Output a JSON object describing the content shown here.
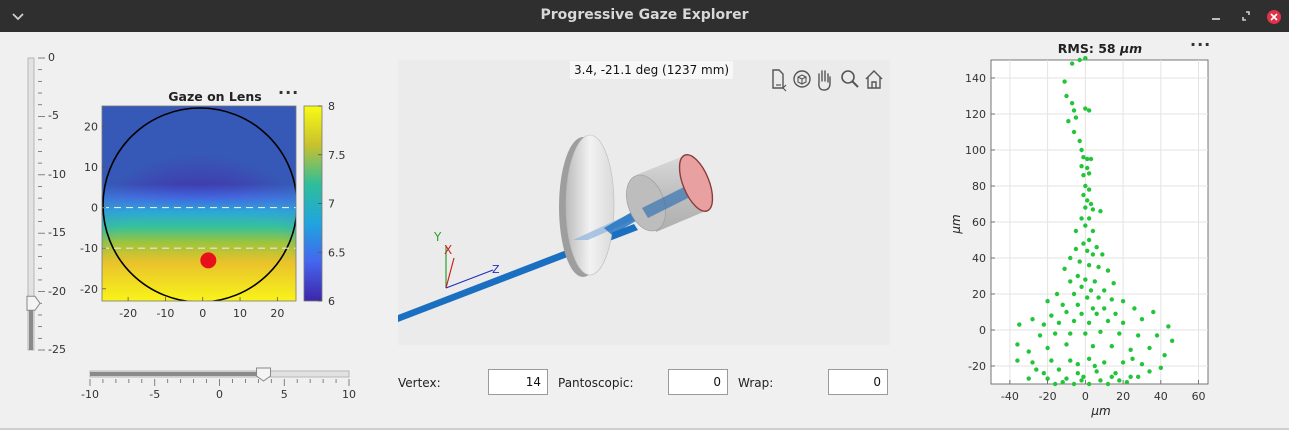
{
  "window": {
    "title": "Progressive Gaze Explorer",
    "colors": {
      "titlebar": "#2f2f2f",
      "close": "#e0334a"
    }
  },
  "vertical_slider": {
    "ticks": [
      "0",
      "-5",
      "-10",
      "-15",
      "-20",
      "-25"
    ],
    "min": -25,
    "max": 0,
    "value": -21
  },
  "horizontal_slider": {
    "ticks": [
      "-10",
      "-5",
      "0",
      "5",
      "10"
    ],
    "min": -10,
    "max": 10,
    "value": 3.4
  },
  "gaze_panel": {
    "title": "Gaze on Lens",
    "x_ticks": [
      "-20",
      "-10",
      "0",
      "10",
      "20"
    ],
    "y_ticks": [
      "20",
      "10",
      "0",
      "-10",
      "-20"
    ],
    "colorbar_ticks": [
      "8",
      "7.5",
      "7",
      "6.5",
      "6"
    ],
    "colorbar_range": [
      6,
      8
    ],
    "gaze_point": {
      "x": 1.5,
      "y": -13
    },
    "dashed_lines_y": [
      0,
      -10
    ],
    "marker_color": "#e8101a"
  },
  "scene_panel": {
    "readout": "3.4, -21.1 deg (1237 mm)",
    "axis_labels": {
      "y": "Y",
      "x": "X",
      "z": "Z"
    },
    "toolbar_icons": [
      "export-icon",
      "rotate-3d-icon",
      "pan-hand-icon",
      "zoom-icon",
      "home-icon"
    ],
    "colors": {
      "ray": "#1a6fc0",
      "lens": "#e6e6e6",
      "eye_cornea": "#e8a0a0"
    }
  },
  "fields": {
    "vertex": {
      "label": "Vertex:",
      "value": "14"
    },
    "pantoscopic": {
      "label": "Pantoscopic:",
      "value": "0"
    },
    "wrap": {
      "label": "Wrap:",
      "value": "0"
    }
  },
  "spot_panel": {
    "title_prefix": "RMS: 58 ",
    "title_unit": "μm",
    "xlabel": "μm",
    "ylabel": "μm"
  },
  "chart_data": {
    "type": "scatter",
    "title": "RMS: 58 μm",
    "xlabel": "μm",
    "ylabel": "μm",
    "xlim": [
      -50,
      65
    ],
    "ylim": [
      -30,
      150
    ],
    "x_ticks": [
      -40,
      -20,
      0,
      20,
      40,
      60
    ],
    "y_ticks": [
      140,
      120,
      100,
      80,
      60,
      40,
      20,
      0,
      -20
    ],
    "grid": true,
    "marker_color": "#22c43a",
    "points": [
      [
        -7,
        148
      ],
      [
        -3,
        150
      ],
      [
        0,
        151
      ],
      [
        -11,
        138
      ],
      [
        -10,
        130
      ],
      [
        -7,
        126
      ],
      [
        -6,
        122
      ],
      [
        -5,
        118
      ],
      [
        0,
        123
      ],
      [
        2,
        122
      ],
      [
        -9,
        116
      ],
      [
        -6,
        110
      ],
      [
        -3,
        105
      ],
      [
        -2,
        100
      ],
      [
        -1,
        96
      ],
      [
        1,
        95
      ],
      [
        3,
        95
      ],
      [
        -2,
        91
      ],
      [
        1,
        90
      ],
      [
        2,
        87
      ],
      [
        -1,
        86
      ],
      [
        0,
        80
      ],
      [
        2,
        78
      ],
      [
        -1,
        75
      ],
      [
        1,
        72
      ],
      [
        3,
        70
      ],
      [
        0,
        68
      ],
      [
        4,
        67
      ],
      [
        8,
        66
      ],
      [
        -2,
        62
      ],
      [
        2,
        62
      ],
      [
        0,
        58
      ],
      [
        -5,
        55
      ],
      [
        4,
        55
      ],
      [
        2,
        50
      ],
      [
        -1,
        48
      ],
      [
        6,
        46
      ],
      [
        -5,
        45
      ],
      [
        1,
        44
      ],
      [
        4,
        42
      ],
      [
        9,
        42
      ],
      [
        -8,
        40
      ],
      [
        -3,
        38
      ],
      [
        2,
        36
      ],
      [
        7,
        35
      ],
      [
        12,
        33
      ],
      [
        -11,
        34
      ],
      [
        -4,
        30
      ],
      [
        0,
        28
      ],
      [
        5,
        27
      ],
      [
        15,
        26
      ],
      [
        -8,
        27
      ],
      [
        -2,
        24
      ],
      [
        3,
        22
      ],
      [
        10,
        22
      ],
      [
        -15,
        20
      ],
      [
        -6,
        20
      ],
      [
        1,
        18
      ],
      [
        7,
        18
      ],
      [
        14,
        17
      ],
      [
        20,
        16
      ],
      [
        -20,
        16
      ],
      [
        -12,
        14
      ],
      [
        -4,
        14
      ],
      [
        4,
        12
      ],
      [
        10,
        12
      ],
      [
        -2,
        9
      ],
      [
        6,
        9
      ],
      [
        16,
        9
      ],
      [
        26,
        12
      ],
      [
        -10,
        10
      ],
      [
        -18,
        8
      ],
      [
        -22,
        3
      ],
      [
        -14,
        4
      ],
      [
        -6,
        5
      ],
      [
        2,
        4
      ],
      [
        12,
        5
      ],
      [
        20,
        4
      ],
      [
        30,
        6
      ],
      [
        36,
        10
      ],
      [
        -35,
        3
      ],
      [
        -28,
        6
      ],
      [
        -24,
        -3
      ],
      [
        -16,
        -2
      ],
      [
        -8,
        -2
      ],
      [
        0,
        -2
      ],
      [
        8,
        -1
      ],
      [
        18,
        -2
      ],
      [
        28,
        -3
      ],
      [
        38,
        -3
      ],
      [
        44,
        2
      ],
      [
        46,
        -6
      ],
      [
        -36,
        -8
      ],
      [
        -30,
        -12
      ],
      [
        -20,
        -10
      ],
      [
        -10,
        -8
      ],
      [
        4,
        -9
      ],
      [
        14,
        -9
      ],
      [
        24,
        -11
      ],
      [
        34,
        -10
      ],
      [
        42,
        -14
      ],
      [
        -36,
        -17
      ],
      [
        -28,
        -18
      ],
      [
        -18,
        -17
      ],
      [
        -8,
        -17
      ],
      [
        2,
        -16
      ],
      [
        10,
        -18
      ],
      [
        20,
        -18
      ],
      [
        30,
        -19
      ],
      [
        40,
        -21
      ],
      [
        -22,
        -24
      ],
      [
        -14,
        -22
      ],
      [
        -4,
        -24
      ],
      [
        6,
        -23
      ],
      [
        16,
        -24
      ],
      [
        24,
        -26
      ],
      [
        -30,
        -27
      ],
      [
        -20,
        -27
      ],
      [
        -10,
        -27
      ],
      [
        -2,
        -28
      ],
      [
        8,
        -28
      ],
      [
        18,
        -28
      ],
      [
        28,
        -26
      ],
      [
        34,
        -23
      ],
      [
        -16,
        -30
      ],
      [
        -6,
        -30
      ],
      [
        2,
        -30
      ],
      [
        12,
        -30
      ],
      [
        22,
        -29
      ],
      [
        -4,
        -19
      ],
      [
        -1,
        -26
      ],
      [
        5,
        -20
      ],
      [
        -12,
        -29
      ],
      [
        14,
        -26
      ],
      [
        -26,
        -22
      ],
      [
        25,
        -16
      ]
    ]
  }
}
